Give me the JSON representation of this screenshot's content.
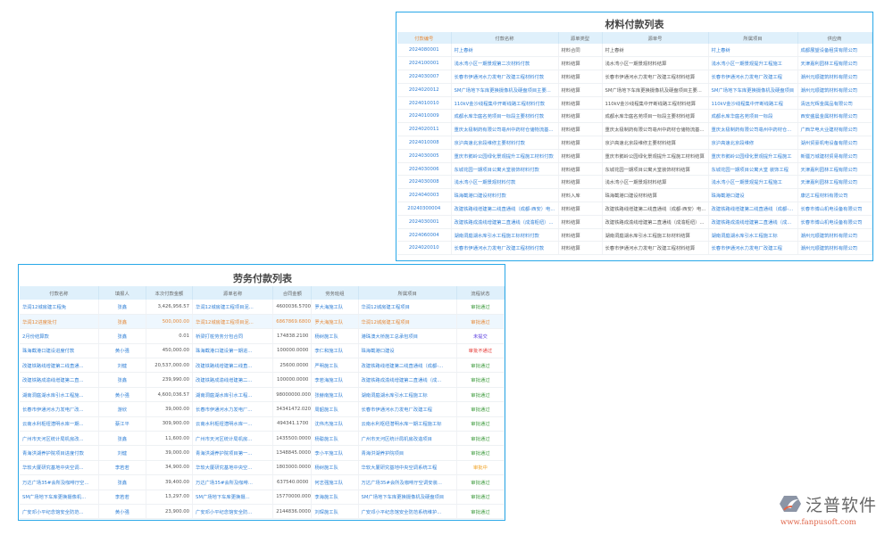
{
  "material": {
    "title": "材料付款列表",
    "headers": [
      "付款编号",
      "付款名称",
      "源单类型",
      "源单号",
      "所属项目",
      "供应商"
    ],
    "rows": [
      [
        "2024080001",
        "村上春树",
        "材料合同",
        "村上春树",
        "村上春树",
        "成都展望设备租赁有限公司"
      ],
      [
        "2024100001",
        "浅水湾小区一期景观第二次材料付款",
        "材料结算",
        "浅水湾小区一期景观材料结算",
        "浅水湾小区一期景观提升工程施工",
        "天津嘉利园林工程有限公司"
      ],
      [
        "2024030007",
        "长春市伊通河水力发电厂改建工程材料付款",
        "材料结算",
        "长春市伊通河水力发电厂改建工程材料结算",
        "长春市伊通河水力发电厂改建工程",
        "潮州元顺建筑材料有限公司"
      ],
      [
        "2024020012",
        "SM广场地下车库更换摄像机及硬盘项目主要...",
        "材料结算",
        "SM广场地下车库更换摄像机及硬盘项目主要...",
        "SM广场地下车库更换摄像机及硬盘项目",
        "潮州元顺建筑材料有限公司"
      ],
      [
        "2024010010",
        "110kV金沙线程集中开断线路工程材料付款",
        "材料结算",
        "110kV金沙线程集中开断线路工程材料结算",
        "110kV金沙线程集中开断线路工程",
        "清远光辉金属品有限公司"
      ],
      [
        "2024010009",
        "成都水库华庭名苑项目一标段主要材料付款",
        "材料结算",
        "成都水库华庭名苑项目一标段主要材料结算",
        "成都水库华庭名苑项目一标段",
        "西安盛晨金属材料有限公司"
      ],
      [
        "2024020011",
        "重庆太极制药有限公司亳州中药材仓储物流基...",
        "材料结算",
        "重庆太极制药有限公司亳州中药材仓储物流基...",
        "重庆太极制药有限公司亳州中药材仓...",
        "广西华电大业建材有限公司"
      ],
      [
        "2024010008",
        "京沪高速北京段维修主要材料付款",
        "材料结算",
        "京沪高速北京段维修主要材料结算",
        "京沪高速北京段维修",
        "湖州贸豪机电设备有限公司"
      ],
      [
        "2024030005",
        "重庆市鹅岭公园绿化景观提升工程施工材料付款",
        "材料结算",
        "重庆市鹅岭公园绿化景观提升工程施工材料结算",
        "重庆市鹅岭公园绿化景观提升工程施工",
        "新疆万城建材贸易有限公司"
      ],
      [
        "2024030006",
        "东城花园一期项目公寓大堂装饰材料付款",
        "材料结算",
        "东城花园一期项目公寓大堂装饰材料结算",
        "东城花园一期项目公寓大堂 装饰工程",
        "天津嘉利园林工程有限公司"
      ],
      [
        "2024030008",
        "浅水湾小区一期景观材料付款",
        "材料结算",
        "浅水湾小区一期景观材料结算",
        "浅水湾小区一期景观提升工程施工",
        "天津嘉利园林工程有限公司"
      ],
      [
        "2024040003",
        "珠海截港口建设材料付款",
        "材料入库",
        "珠海截港口建设材料结算",
        "珠海截港口建设",
        "康达工程材料有限公司"
      ],
      [
        "20240300004",
        "改建铁路线增建第二线直通线（成都-西安）电...",
        "材料结算",
        "改建铁路线增建第二线直通线（成都-西安）电...",
        "改建铁路线增建第二线直通线（成都-...",
        "长春市博山机电设备有限公司"
      ],
      [
        "2024030001",
        "改建铁路成渝线增建第二直通线（成渝枢纽）...",
        "材料结算",
        "改建铁路成渝线增建第二直通线（成渝枢纽）...",
        "改建铁路成渝线增建第二直通线（成...",
        "长春市博山机电设备有限公司"
      ],
      [
        "2024060004",
        "湖南洞庭湖水库引水工程施工标材料付款",
        "材料结算",
        "湖南洞庭湖水库引水工程施工标材料结算",
        "湖南洞庭湖水库引水工程施工标",
        "潮州元顺建筑材料有限公司"
      ],
      [
        "2024020010",
        "长春市伊通河水力发电厂改建工程材料付款",
        "材料结算",
        "长春市伊通河水力发电厂改建工程材料结算",
        "长春市伊通河水力发电厂改建工程",
        "潮州元顺建筑材料有限公司"
      ]
    ]
  },
  "labor": {
    "title": "劳务付款列表",
    "headers": [
      "付款名称",
      "填报人",
      "本次付款金额",
      "源单名称",
      "合同金额",
      "劳务班组",
      "所属项目",
      "流程状态"
    ],
    "rows": [
      [
        "华润12城房建工程免",
        "张鑫",
        "3,426,956.57",
        "华润12城房建工程项目泥...",
        "4600036.5700",
        "罗大海施工队",
        "华润12城房建工程项目",
        "审批通过"
      ],
      [
        "华润12进度批付",
        "张鑫",
        "500,000.00",
        "华润12城房建工程项目泥...",
        "6867869.6800",
        "罗大海施工队",
        "华润12城房建工程项目",
        "审批通过"
      ],
      [
        "2月份结算款",
        "张鑫",
        "0.01",
        "桥梁打桩劳务分包合同",
        "174838.2100",
        "杨树施工队",
        "港珠澳大桥施工总承包项目",
        "未提交"
      ],
      [
        "珠海截港口建设进度付款",
        "黄小强",
        "450,000.00",
        "珠海截港口建设第一期进...",
        "100000.0000",
        "李仁和施工队",
        "珠海截港口建设",
        "审批不通过"
      ],
      [
        "改建铁路线增建第二线直通...",
        "刘健",
        "20,537,000.00",
        "改建铁路线增建第二线直...",
        "25600.0000",
        "严明施工队",
        "改建铁路线增建第二线直通线（成都-...",
        "审批通过"
      ],
      [
        "改建铁路成渝线增建第二直...",
        "张鑫",
        "239,990.00",
        "改建铁路成渝线增建第二...",
        "100000.0000",
        "李若海施工队",
        "改建铁路成渝线增建第二直通线（成...",
        "审批通过"
      ],
      [
        "湖南洞庭湖水库引水工程施...",
        "黄小强",
        "4,600,036.57",
        "湖南洞庭湖水库引水工程...",
        "98000000.0000",
        "张赫南施工队",
        "湖南洞庭湖水库引水工程施工标",
        "审批通过"
      ],
      [
        "长春市伊通河水力发电厂改...",
        "游欣",
        "39,000.00",
        "长春市伊通河水力发电厂...",
        "34341472.0200",
        "周韶施工队",
        "长春市伊通河水力发电厂改建工程",
        "审批通过"
      ],
      [
        "云南水利枢纽潜明水库一期...",
        "蔡江平",
        "309,900.00",
        "云南水利枢纽潜明水库一...",
        "494341.1700",
        "沈伟杰施工队",
        "云南水利枢纽潜明水库一期工程施工标",
        "审批通过"
      ],
      [
        "广州市天河区统计局机房改...",
        "张鑫",
        "11,600.00",
        "广州市天河区统计局机房...",
        "1435500.0000",
        "杨聪施工队",
        "广州市天河区统计局机房改造项目",
        "审批通过"
      ],
      [
        "青海洪湖养护院项目进度付款",
        "刘健",
        "39,000.00",
        "青海洪湖养护院项目第一...",
        "1348845.0000",
        "李小平施工队",
        "青海洪湖养护院项目",
        "审批通过"
      ],
      [
        "华软大厦研究基地中央空调...",
        "李若若",
        "34,900.00",
        "华软大厦研究基地中央空...",
        "1803000.0000",
        "杨树施工队",
        "华软大厦研究基地中央空调系统工程",
        "审批中"
      ],
      [
        "万达广场35#会所及咖啡厅空...",
        "张鑫",
        "39,400.00",
        "万达广场35#会所及咖啡...",
        "637540.0000",
        "何志强施工队",
        "万达广场35#会所及咖啡厅空调安装...",
        "审批通过"
      ],
      [
        "SM广场地下车库更换摄像机...",
        "李若若",
        "13,297.00",
        "SM广场地下车库更换摄...",
        "15770000.0000",
        "李海施工队",
        "SM广场地下车库更换摄像机及硬盘项目",
        "审批通过"
      ],
      [
        "广安邓小平纪念馆安全防范...",
        "黄小强",
        "23,900.00",
        "广安邓小平纪念馆安全防...",
        "2144836.0000",
        "刘琛施工队",
        "广安邓小平纪念馆安全防范系统维护...",
        "审批通过"
      ]
    ],
    "highlighted_row": 1,
    "status_colors": {
      "审批通过": "#3c9a3c",
      "未提交": "#5b3fe0",
      "审批不通过": "#e53935",
      "审批中": "#f0a020"
    }
  },
  "logo": {
    "name": "泛普软件",
    "url": "www.fanpusoft.com"
  },
  "colors": {
    "accent": "#29a8e8",
    "link": "#2f7fd6",
    "header_bg": "#dff0fb"
  }
}
